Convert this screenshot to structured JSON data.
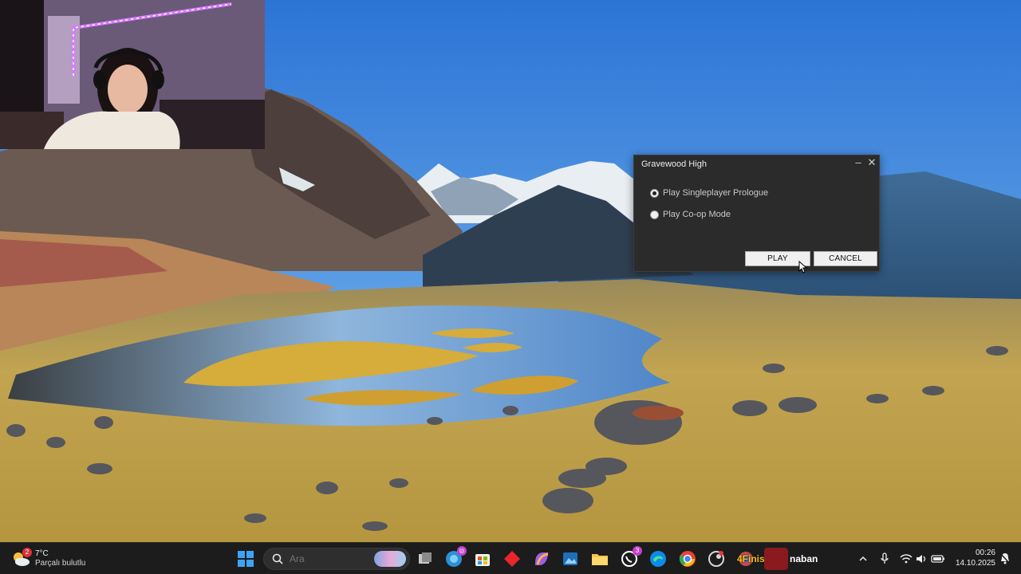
{
  "dialog": {
    "title": "Gravewood High",
    "options": [
      {
        "label": "Play Singleplayer Prologue",
        "selected": true
      },
      {
        "label": "Play Co-op Mode",
        "selected": false
      }
    ],
    "play_label": "PLAY",
    "cancel_label": "CANCEL"
  },
  "taskbar": {
    "weather": {
      "badge": "2",
      "temperature": "7°C",
      "condition": "Parçalı bulutlu"
    },
    "search": {
      "placeholder": "Ara"
    },
    "whatsapp_badge": "3",
    "active_game_label": "4Finisher",
    "active_game_label_2": "naban",
    "clock": {
      "time": "00:26",
      "date": "14.10.2025"
    }
  },
  "colors": {
    "dialog_bg": "#2b2b2b",
    "taskbar_bg": "#1c1c1c",
    "badge_red": "#d8333a",
    "badge_purple": "#c142c9",
    "game_label_yellow": "#f1c21b"
  }
}
